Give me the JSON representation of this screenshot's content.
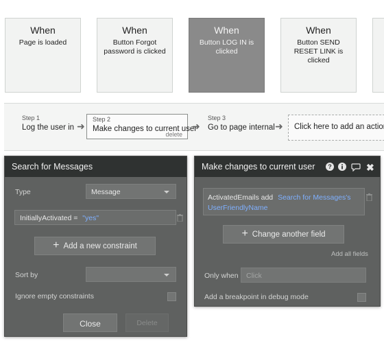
{
  "events": [
    {
      "when": "When",
      "desc": "Page is loaded"
    },
    {
      "when": "When",
      "desc": "Button Forgot password is clicked"
    },
    {
      "when": "When",
      "desc": "Button LOG IN is clicked"
    },
    {
      "when": "When",
      "desc": "Button SEND RESET LINK is clicked"
    }
  ],
  "steps": {
    "items": [
      {
        "num": "Step 1",
        "label": "Log the user in"
      },
      {
        "num": "Step 2",
        "label": "Make changes to current user",
        "delete": "delete"
      },
      {
        "num": "Step 3",
        "label": "Go to page internal"
      }
    ],
    "add_action": "Click here to add an action..."
  },
  "search_panel": {
    "title": "Search for Messages",
    "type_label": "Type",
    "type_value": "Message",
    "constraint_key": "InitiallyActivated =",
    "constraint_value": "\"yes\"",
    "add_constraint": "Add a new constraint",
    "sort_label": "Sort by",
    "ignore_label": "Ignore empty constraints",
    "close": "Close",
    "delete": "Delete"
  },
  "change_panel": {
    "title": "Make changes to current user",
    "field_key": "ActivatedEmails add",
    "field_value_1": "Search for Messages's",
    "field_value_2": "UserFriendlyName",
    "change_another": "Change another field",
    "add_all_fields": "Add all fields",
    "only_when_label": "Only when",
    "only_when_placeholder": "Click",
    "breakpoint_label": "Add a breakpoint in debug mode"
  },
  "colors": {
    "panel_bg": "#5f6160",
    "panel_header": "#2f3231",
    "active_card": "#8a8a8a",
    "link_blue": "#7fb0ff"
  }
}
